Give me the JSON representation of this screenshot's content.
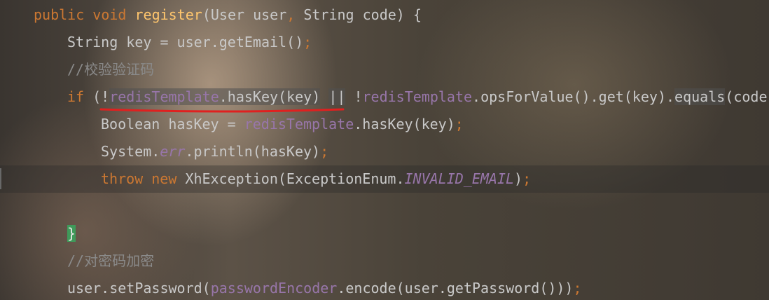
{
  "colors": {
    "keyword": "#cc7832",
    "method_declaration": "#ffc66d",
    "field": "#9876aa",
    "comment": "#8a8a8a",
    "plain": "#c9c9c9",
    "annotation_underline": "#e0201f",
    "brace_match": "#3f9a5a"
  },
  "code_lines": [
    {
      "segments": [
        {
          "text": "public void ",
          "cls": "kw"
        },
        {
          "text": "register",
          "cls": "fn"
        },
        {
          "text": "(User user",
          "cls": "plain"
        },
        {
          "text": ", ",
          "cls": "kw"
        },
        {
          "text": "String code) {",
          "cls": "plain"
        }
      ]
    },
    {
      "segments": [
        {
          "text": "String key = user.getEmail()",
          "cls": "plain"
        },
        {
          "text": ";",
          "cls": "kw"
        }
      ]
    },
    {
      "segments": [
        {
          "text": "//校验验证码",
          "cls": "comment"
        }
      ]
    },
    {
      "segments": [
        {
          "text": "if ",
          "cls": "kw"
        },
        {
          "text": "(!",
          "cls": "plain"
        },
        {
          "text": "redisTemplate",
          "cls": "field hl"
        },
        {
          "text": ".hasKey(key)",
          "cls": "plain hl"
        },
        {
          "text": " ",
          "cls": "plain"
        },
        {
          "text": "||",
          "cls": "plain hl"
        },
        {
          "text": " !",
          "cls": "plain"
        },
        {
          "text": "redisTemplate",
          "cls": "field"
        },
        {
          "text": ".opsForValue().get(key).",
          "cls": "plain"
        },
        {
          "text": "equals",
          "cls": "plain hl"
        },
        {
          "text": "(code)",
          "cls": "plain"
        }
      ]
    },
    {
      "segments": [
        {
          "text": "Boolean hasKey = ",
          "cls": "plain"
        },
        {
          "text": "redisTemplate",
          "cls": "field"
        },
        {
          "text": ".hasKey(key)",
          "cls": "plain"
        },
        {
          "text": ";",
          "cls": "kw"
        }
      ]
    },
    {
      "segments": [
        {
          "text": "System.",
          "cls": "plain"
        },
        {
          "text": "err",
          "cls": "staticf"
        },
        {
          "text": ".println(hasKey)",
          "cls": "plain"
        },
        {
          "text": ";",
          "cls": "kw"
        }
      ]
    },
    {
      "segments": [
        {
          "text": "throw new ",
          "cls": "kw"
        },
        {
          "text": "XhException(ExceptionEnum.",
          "cls": "plain"
        },
        {
          "text": "INVALID_EMAIL",
          "cls": "staticf"
        },
        {
          "text": ")",
          "cls": "plain"
        },
        {
          "text": ";",
          "cls": "kw"
        }
      ]
    },
    {
      "segments": []
    },
    {
      "segments": [
        {
          "text": "}",
          "cls": "brace-hl"
        }
      ]
    },
    {
      "segments": [
        {
          "text": "//对密码加密",
          "cls": "comment"
        }
      ]
    },
    {
      "segments": [
        {
          "text": "user.setPassword(",
          "cls": "plain"
        },
        {
          "text": "passwordEncoder",
          "cls": "field"
        },
        {
          "text": ".encode(user.getPassword()))",
          "cls": "plain"
        },
        {
          "text": ";",
          "cls": "kw"
        }
      ]
    }
  ]
}
